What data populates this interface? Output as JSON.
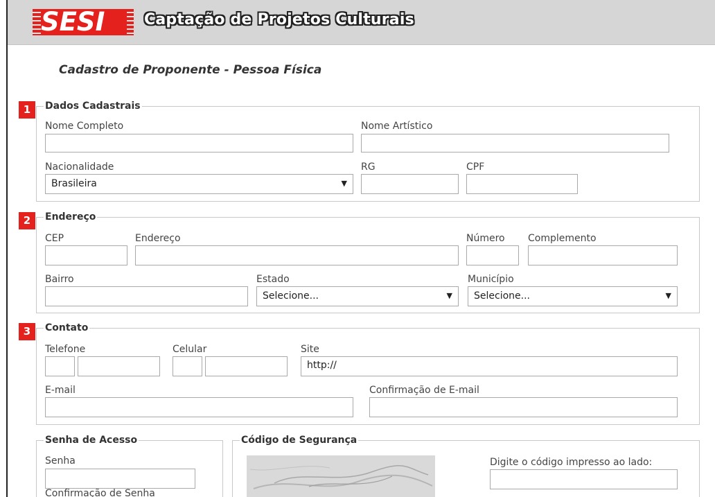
{
  "header": {
    "logo_text": "SESI",
    "app_title": "Captação de Projetos Culturais"
  },
  "page_title": "Cadastro de Proponente - Pessoa Física",
  "sections": {
    "dados": {
      "badge": "1",
      "legend": "Dados Cadastrais",
      "nome_completo_label": "Nome Completo",
      "nome_artistico_label": "Nome Artístico",
      "nacionalidade_label": "Nacionalidade",
      "nacionalidade_value": "Brasileira",
      "rg_label": "RG",
      "cpf_label": "CPF"
    },
    "endereco": {
      "badge": "2",
      "legend": "Endereço",
      "cep_label": "CEP",
      "endereco_label": "Endereço",
      "numero_label": "Número",
      "complemento_label": "Complemento",
      "bairro_label": "Bairro",
      "estado_label": "Estado",
      "estado_value": "Selecione...",
      "municipio_label": "Município",
      "municipio_value": "Selecione..."
    },
    "contato": {
      "badge": "3",
      "legend": "Contato",
      "telefone_label": "Telefone",
      "celular_label": "Celular",
      "site_label": "Site",
      "site_value": "http://",
      "email_label": "E-mail",
      "email_confirm_label": "Confirmação de E-mail"
    },
    "senha": {
      "legend": "Senha de Acesso",
      "senha_label": "Senha",
      "confirm_label": "Confirmação de Senha"
    },
    "codigo": {
      "legend": "Código de Segurança",
      "prompt_label": "Digite o código impresso ao lado:"
    }
  },
  "icons": {
    "dropdown": "chevron-down-icon"
  },
  "colors": {
    "brand_red": "#e4211d",
    "header_bg": "#d6d6d6"
  }
}
